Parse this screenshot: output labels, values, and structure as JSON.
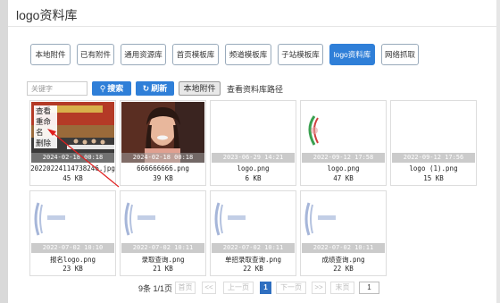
{
  "page": {
    "title": "logo资料库"
  },
  "tabs": [
    {
      "label": "本地附件",
      "active": false
    },
    {
      "label": "已有附件",
      "active": false
    },
    {
      "label": "通用资源库",
      "active": false
    },
    {
      "label": "首页模板库",
      "active": false
    },
    {
      "label": "频道模板库",
      "active": false
    },
    {
      "label": "子站模板库",
      "active": false
    },
    {
      "label": "logo资料库",
      "active": true
    },
    {
      "label": "网络抓取",
      "active": false
    }
  ],
  "toolbar": {
    "search_placeholder": "关键字",
    "search_label": "搜索",
    "search_icon": "search-icon",
    "refresh_label": "刷新",
    "refresh_icon": "refresh-icon",
    "local_label": "本地附件",
    "path_label": "查看资料库路径"
  },
  "overlay_menu": {
    "items": [
      "查看",
      "重命名",
      "删除"
    ]
  },
  "files": [
    {
      "date": "2024-02-18 00:18",
      "name": "20220224114738246.jpg",
      "size": "45 KB",
      "thumb": "photo-meeting"
    },
    {
      "date": "2024-02-18 00:18",
      "name": "666666666.png",
      "size": "39 KB",
      "thumb": "photo-portrait"
    },
    {
      "date": "2023-06-29 14:21",
      "name": "logo.png",
      "size": "6 KB",
      "thumb": "blank"
    },
    {
      "date": "2022-09-12 17:58",
      "name": "logo.png",
      "size": "47 KB",
      "thumb": "logo-circle"
    },
    {
      "date": "2022-09-12 17:56",
      "name": "logo (1).png",
      "size": "15 KB",
      "thumb": "blank"
    },
    {
      "date": "2022-07-02 10:10",
      "name": "报名logo.png",
      "size": "23 KB",
      "thumb": "logo-faded"
    },
    {
      "date": "2022-07-02 10:11",
      "name": "录取查询.png",
      "size": "21 KB",
      "thumb": "logo-faded"
    },
    {
      "date": "2022-07-02 10:11",
      "name": "单招录取查询.png",
      "size": "22 KB",
      "thumb": "logo-faded"
    },
    {
      "date": "2022-07-02 10:11",
      "name": "成绩查询.png",
      "size": "22 KB",
      "thumb": "logo-faded"
    }
  ],
  "pagination": {
    "summary": "9条 1/1页",
    "first": "首页",
    "prev_arrow": "<<",
    "prev": "上一页",
    "current": "1",
    "next": "下一页",
    "next_arrow": ">>",
    "last": "末页",
    "page_input": "1"
  },
  "colors": {
    "accent": "#2f7fd8",
    "annotation": "#e02020"
  }
}
